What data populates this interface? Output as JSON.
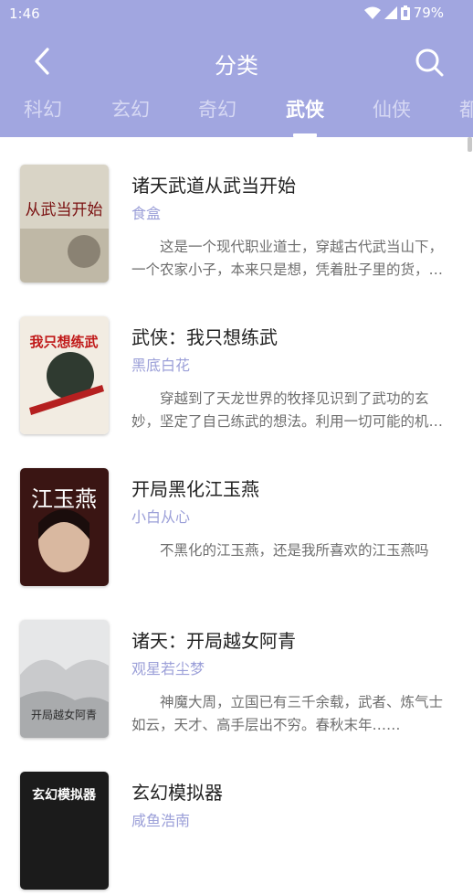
{
  "status": {
    "time": "1:46",
    "battery": "79%"
  },
  "header": {
    "title": "分类"
  },
  "tabs": [
    {
      "label": "科幻"
    },
    {
      "label": "玄幻"
    },
    {
      "label": "奇幻"
    },
    {
      "label": "武侠"
    },
    {
      "label": "仙侠"
    },
    {
      "label": "都"
    }
  ],
  "active_tab": "武侠",
  "books": [
    {
      "title": "诸天武道从武当开始",
      "author": "食盒",
      "desc": "这是一个现代职业道士，穿越古代武当山下，一个农家小子，本来只是想，凭着肚子里的货，养家糊口……",
      "cover_text": "从武当开始",
      "cover_color": "#d9d4c6"
    },
    {
      "title": "武侠：我只想练武",
      "author": "黑底白花",
      "desc": "穿越到了天龙世界的牧择见识到了武功的玄妙，坚定了自己练武的想法。利用一切可能的机会……",
      "cover_text": "我只想练武",
      "cover_color": "#f2ece2"
    },
    {
      "title": "开局黑化江玉燕",
      "author": "小白从心",
      "desc": "不黑化的江玉燕，还是我所喜欢的江玉燕吗",
      "cover_text": "江玉燕",
      "cover_color": "#3a1513"
    },
    {
      "title": "诸天：开局越女阿青",
      "author": "观星若尘梦",
      "desc": "神魔大周，立国已有三千余载，武者、炼气士如云，天才、高手层出不穷。春秋末年……",
      "cover_text": "开局越女阿青",
      "cover_color": "#e6e7e8"
    },
    {
      "title": "玄幻模拟器",
      "author": "咸鱼浩南",
      "desc": "",
      "cover_text": "玄幻模拟器",
      "cover_color": "#1b1b1b"
    }
  ]
}
